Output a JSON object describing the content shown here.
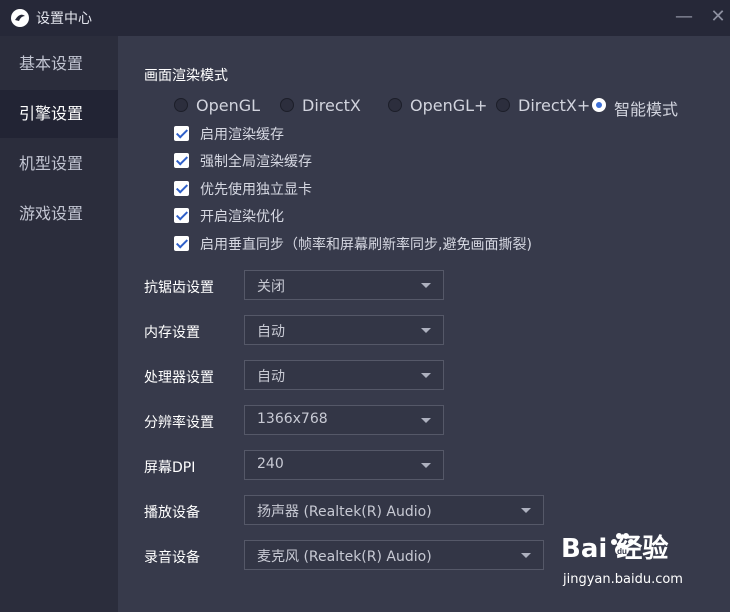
{
  "window": {
    "title": "设置中心"
  },
  "sidebar": {
    "items": [
      {
        "label": "基本设置",
        "active": false
      },
      {
        "label": "引擎设置",
        "active": true
      },
      {
        "label": "机型设置",
        "active": false
      },
      {
        "label": "游戏设置",
        "active": false
      }
    ]
  },
  "render_mode": {
    "title": "画面渲染模式",
    "options": [
      "OpenGL",
      "DirectX",
      "OpenGL+",
      "DirectX+",
      "智能模式"
    ],
    "selected": "智能模式"
  },
  "checkboxes": [
    {
      "label": "启用渲染缓存",
      "checked": true
    },
    {
      "label": "强制全局渲染缓存",
      "checked": true
    },
    {
      "label": "优先使用独立显卡",
      "checked": true
    },
    {
      "label": "开启渲染优化",
      "checked": true
    },
    {
      "label": "启用垂直同步（帧率和屏幕刷新率同步,避免画面撕裂)",
      "checked": true
    }
  ],
  "settings": {
    "antialias": {
      "label": "抗锯齿设置",
      "value": "关闭"
    },
    "memory": {
      "label": "内存设置",
      "value": "自动"
    },
    "cpu": {
      "label": "处理器设置",
      "value": "自动"
    },
    "resolution": {
      "label": "分辨率设置",
      "value": "1366x768"
    },
    "dpi": {
      "label": "屏幕DPI",
      "value": "240"
    },
    "playback": {
      "label": "播放设备",
      "value": "扬声器 (Realtek(R) Audio)"
    },
    "record": {
      "label": "录音设备",
      "value": "麦克风 (Realtek(R) Audio)"
    }
  },
  "watermark": {
    "logo": "Bai  经验",
    "url": "jingyan.baidu.com"
  },
  "colors": {
    "accent": "#3d6fd6",
    "panel": "#373a4b",
    "sidebar": "#2b2d3c"
  }
}
